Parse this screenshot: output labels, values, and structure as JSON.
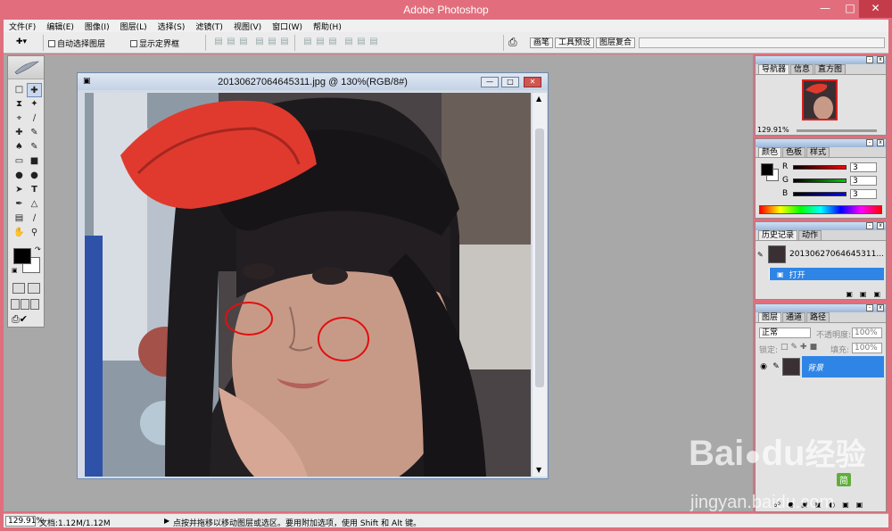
{
  "app": {
    "title": "Adobe Photoshop"
  },
  "menu": [
    "文件(F)",
    "编辑(E)",
    "图像(I)",
    "图层(L)",
    "选择(S)",
    "滤镜(T)",
    "视图(V)",
    "窗口(W)",
    "帮助(H)"
  ],
  "options": {
    "auto_select": "自动选择图层",
    "show_bounds": "显示定界框",
    "well_tabs": [
      "画笔",
      "工具预设",
      "图层复合"
    ]
  },
  "document": {
    "title": "20130627064645311.jpg @ 130%(RGB/8#)"
  },
  "navigator": {
    "tabs": [
      "导航器",
      "信息",
      "直方图"
    ],
    "zoom": "129.91%"
  },
  "color": {
    "tabs": [
      "颜色",
      "色板",
      "样式"
    ],
    "channels": [
      {
        "label": "R",
        "value": "3"
      },
      {
        "label": "G",
        "value": "3"
      },
      {
        "label": "B",
        "value": "3"
      }
    ]
  },
  "history": {
    "tabs": [
      "历史记录",
      "动作"
    ],
    "snapshot": "20130627064645311...",
    "items": [
      {
        "label": "打开"
      }
    ]
  },
  "layers": {
    "tabs": [
      "图层",
      "通道",
      "路径"
    ],
    "blend_mode": "正常",
    "opacity_label": "不透明度:",
    "opacity": "100%",
    "lock_label": "锁定:",
    "fill_label": "填充:",
    "fill": "100%",
    "items": [
      {
        "name": "背景"
      }
    ]
  },
  "status": {
    "zoom": "129.91%",
    "doc_size": "文档:1.12M/1.12M",
    "message": "点按并拖移以移动图层或选区。要用附加选项，使用 Shift 和 Alt 键。"
  },
  "watermark": {
    "brand": "Bai",
    "brand2": "du",
    "brand_cn": "经验",
    "url": "jingyan.baidu.com",
    "badge": "简"
  },
  "colors": {
    "titlebar": "#e26e7d",
    "workspace": "#a8a8a8",
    "cap": "#e03a2e",
    "selection": "#2f85e6",
    "annotation": "#e01010"
  }
}
